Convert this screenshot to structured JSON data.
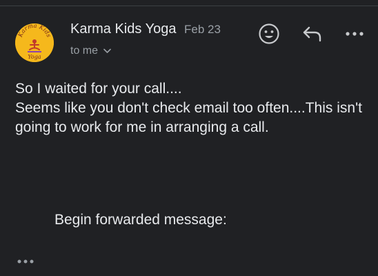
{
  "message": {
    "sender_name": "Karma Kids Yoga",
    "date": "Feb 23",
    "recipient_label": "to me",
    "body_lines": [
      "So I waited for your call....",
      "Seems like you don't check email too often....This isn't going to work for me in arranging a call."
    ],
    "forwarded_label": "Begin forwarded message:"
  },
  "avatar": {
    "logo_text_top": "Karma Kids",
    "logo_text_bottom": "Yoga",
    "background_color": "#f5b81c"
  },
  "actions": {
    "emoji_icon": "smiley-face-icon",
    "reply_icon": "reply-arrow-icon",
    "more_icon": "more-horizontal-icon",
    "trimmed_icon": "show-trimmed-content-icon"
  },
  "colors": {
    "background": "#202124",
    "primary_text": "#e8eaed",
    "secondary_text": "#9aa0a6"
  }
}
